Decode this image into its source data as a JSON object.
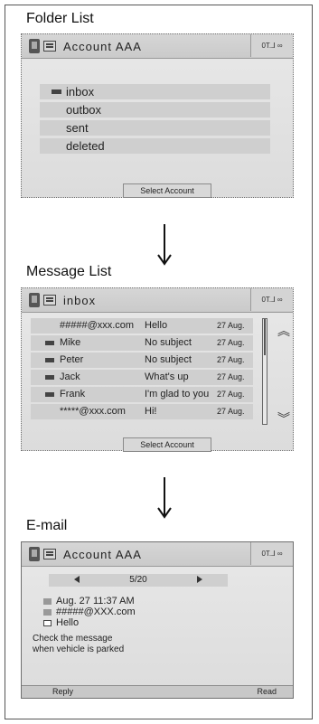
{
  "sections": {
    "folder_list": "Folder List",
    "message_list": "Message List",
    "email": "E-mail"
  },
  "folder_screen": {
    "title": "Account AAA",
    "status": "0T.⅃ ∞",
    "folders": [
      "inbox",
      "outbox",
      "sent",
      "deleted"
    ],
    "select_account": "Select Account"
  },
  "message_screen": {
    "title": "inbox",
    "status": "0T.⅃ ∞",
    "messages": [
      {
        "from": "#####@xxx.com",
        "subject": "Hello",
        "date": "27 Aug."
      },
      {
        "from": "Mike",
        "subject": "No subject",
        "date": "27 Aug."
      },
      {
        "from": "Peter",
        "subject": "No subject",
        "date": "27 Aug."
      },
      {
        "from": "Jack",
        "subject": "What's up",
        "date": "27 Aug."
      },
      {
        "from": "Frank",
        "subject": "I'm glad to you",
        "date": "27 Aug."
      },
      {
        "from": "*****@xxx.com",
        "subject": "Hi!",
        "date": "27 Aug."
      }
    ],
    "select_account": "Select Account"
  },
  "email_screen": {
    "title": "Account AAA",
    "status": "0T.⅃ ∞",
    "page_counter": "5/20",
    "date": "Aug. 27 11:37 AM",
    "from": "#####@XXX.com",
    "subject": "Hello",
    "body_line1": "Check the message",
    "body_line2": "when vehicle is parked",
    "reply": "Reply",
    "read": "Read"
  }
}
